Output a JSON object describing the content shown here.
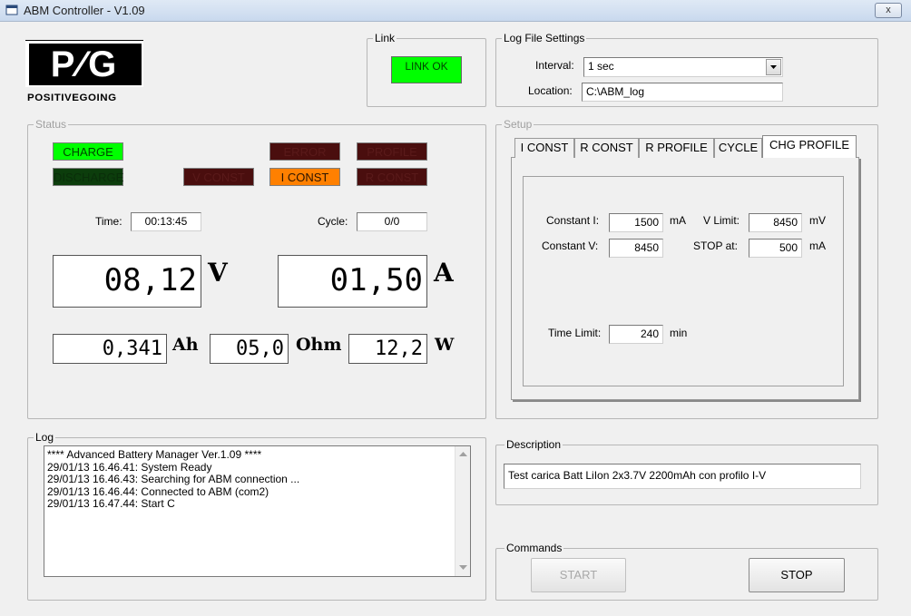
{
  "window": {
    "title": "ABM Controller - V1.09",
    "close_label": "x"
  },
  "logo": {
    "text": "P∕G",
    "tagline": "POSITIVEGOING"
  },
  "link": {
    "legend": "Link",
    "status": "LINK OK"
  },
  "log_settings": {
    "legend": "Log File Settings",
    "interval_label": "Interval:",
    "interval_value": "1 sec",
    "location_label": "Location:",
    "location_value": "C:\\ABM_log"
  },
  "status": {
    "legend": "Status",
    "indicators": {
      "charge": "CHARGE",
      "discharge": "DISCHARGE",
      "error": "ERROR",
      "profile": "PROFILE",
      "v_const": "V CONST",
      "i_const": "I CONST",
      "r_const": "R CONST"
    },
    "time_label": "Time:",
    "time_value": "00:13:45",
    "cycle_label": "Cycle:",
    "cycle_value": "0/0",
    "voltage": "08,12",
    "voltage_unit": "V",
    "current": "01,50",
    "current_unit": "A",
    "capacity": "0,341",
    "capacity_unit": "Ah",
    "resistance": "05,0",
    "resistance_unit": "Ohm",
    "power": "12,2",
    "power_unit": "W"
  },
  "setup": {
    "legend": "Setup",
    "tabs": [
      "I CONST",
      "R CONST",
      "R PROFILE",
      "CYCLE",
      "CHG PROFILE"
    ],
    "constant_i_label": "Constant I:",
    "constant_i_value": "1500",
    "constant_i_unit": "mA",
    "v_limit_label": "V Limit:",
    "v_limit_value": "8450",
    "v_limit_unit": "mV",
    "constant_v_label": "Constant V:",
    "constant_v_value": "8450",
    "stop_at_label": "STOP at:",
    "stop_at_value": "500",
    "stop_at_unit": "mA",
    "time_limit_label": "Time Limit:",
    "time_limit_value": "240",
    "time_limit_unit": "min"
  },
  "log": {
    "legend": "Log",
    "lines": [
      "**** Advanced Battery Manager Ver.1.09 ****",
      "29/01/13 16.46.41: System Ready",
      "29/01/13 16.46.43: Searching for ABM connection ...",
      "29/01/13 16.46.44: Connected to ABM (com2)",
      "29/01/13 16.47.44: Start C"
    ]
  },
  "description": {
    "legend": "Description",
    "value": "Test carica Batt LiIon 2x3.7V 2200mAh con profilo I-V"
  },
  "commands": {
    "legend": "Commands",
    "start_label": "START",
    "stop_label": "STOP"
  }
}
